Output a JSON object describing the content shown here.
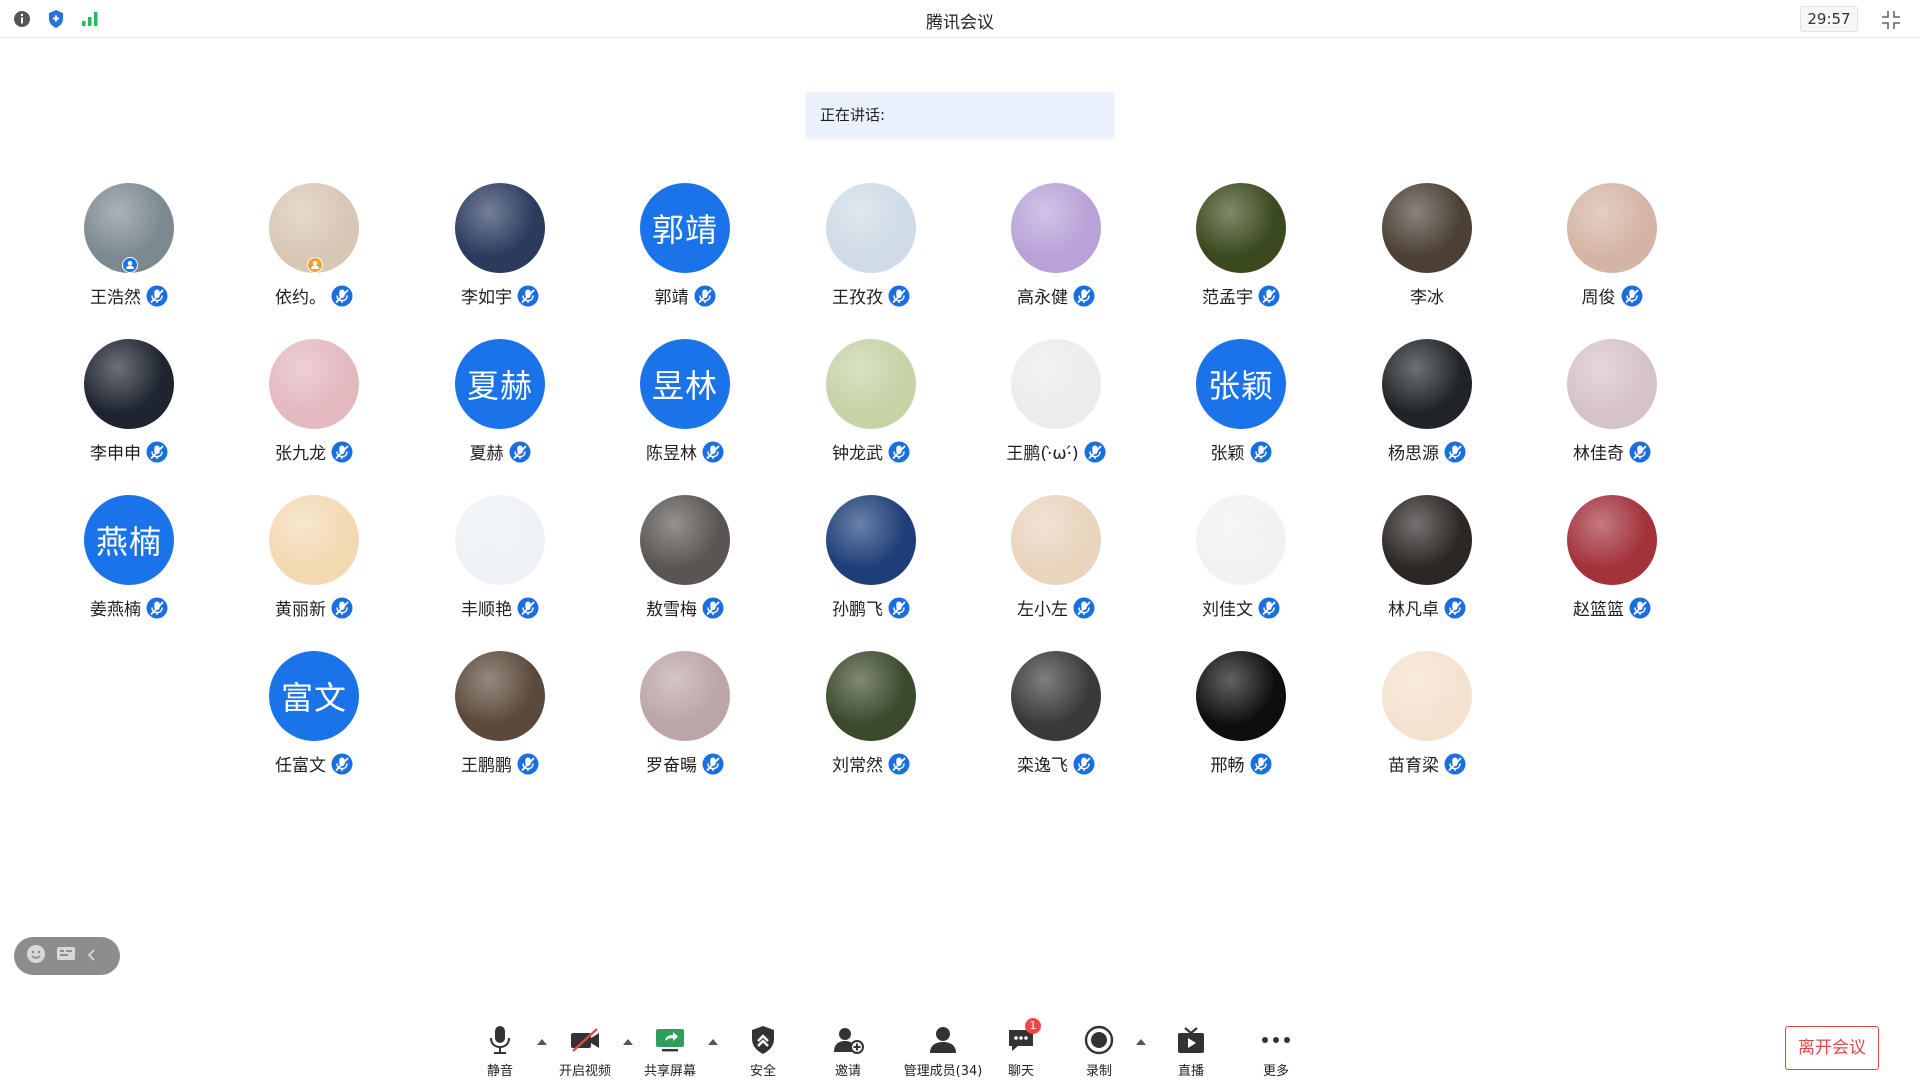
{
  "titlebar": {
    "title": "腾讯会议",
    "timer": "29:57",
    "icons": [
      "info-icon",
      "shield-icon",
      "signal-icon",
      "fullscreen-icon"
    ]
  },
  "speaking": {
    "label": "正在讲话:"
  },
  "participants": [
    {
      "name": "王浩然",
      "avatar": "photo",
      "color": "#7c8a90",
      "badge": "host"
    },
    {
      "name": "依约。",
      "avatar": "photo",
      "color": "#d8c7b5",
      "badge": "cohost"
    },
    {
      "name": "李如宇",
      "avatar": "photo",
      "color": "#2b3b5e"
    },
    {
      "name": "郭靖",
      "avatar": "text",
      "text": "郭靖"
    },
    {
      "name": "王孜孜",
      "avatar": "photo",
      "color": "#cfdbe6"
    },
    {
      "name": "高永健",
      "avatar": "photo",
      "color": "#b9a2d8"
    },
    {
      "name": "范孟宇",
      "avatar": "photo",
      "color": "#3a4a1e"
    },
    {
      "name": "李冰",
      "avatar": "photo",
      "color": "#4c4035",
      "mic": false
    },
    {
      "name": "周俊",
      "avatar": "photo",
      "color": "#d4b5a3"
    },
    {
      "name": "李申申",
      "avatar": "photo",
      "color": "#1e2530"
    },
    {
      "name": "张九龙",
      "avatar": "photo",
      "color": "#e4b8bf"
    },
    {
      "name": "夏赫",
      "avatar": "text",
      "text": "夏赫"
    },
    {
      "name": "陈昱林",
      "avatar": "text",
      "text": "昱林"
    },
    {
      "name": "钟龙武",
      "avatar": "photo",
      "color": "#c5d3a6"
    },
    {
      "name": "王鹏(·̀ω·́)",
      "avatar": "photo",
      "color": "#ececec"
    },
    {
      "name": "张颖",
      "avatar": "text",
      "text": "张颖"
    },
    {
      "name": "杨思源",
      "avatar": "photo",
      "color": "#202428"
    },
    {
      "name": "林佳奇",
      "avatar": "photo",
      "color": "#d6c3c8"
    },
    {
      "name": "姜燕楠",
      "avatar": "text",
      "text": "燕楠"
    },
    {
      "name": "黄丽新",
      "avatar": "photo",
      "color": "#f3d9b2"
    },
    {
      "name": "丰顺艳",
      "avatar": "photo",
      "color": "#eef2f6"
    },
    {
      "name": "敖雪梅",
      "avatar": "photo",
      "color": "#5a5552"
    },
    {
      "name": "孙鹏飞",
      "avatar": "photo",
      "color": "#1d3e78"
    },
    {
      "name": "左小左",
      "avatar": "photo",
      "color": "#e9d4bd"
    },
    {
      "name": "刘佳文",
      "avatar": "photo",
      "color": "#f2f2f2"
    },
    {
      "name": "林凡卓",
      "avatar": "photo",
      "color": "#2c2624"
    },
    {
      "name": "赵篮篮",
      "avatar": "photo",
      "color": "#a3323b"
    },
    {
      "name": "任富文",
      "avatar": "text",
      "text": "富文"
    },
    {
      "name": "王鹏鹏",
      "avatar": "photo",
      "color": "#5b4a3b"
    },
    {
      "name": "罗奋暘",
      "avatar": "photo",
      "color": "#bba5a6"
    },
    {
      "name": "刘常然",
      "avatar": "photo",
      "color": "#3b4a2b"
    },
    {
      "name": "栾逸飞",
      "avatar": "photo",
      "color": "#3a3a3a"
    },
    {
      "name": "邢畅",
      "avatar": "photo",
      "color": "#0e0e0e"
    },
    {
      "name": "苗育梁",
      "avatar": "photo",
      "color": "#f4e2cf"
    }
  ],
  "toolbar": {
    "mute": "静音",
    "video": "开启视频",
    "share": "共享屏幕",
    "security": "安全",
    "invite": "邀请",
    "members": "管理成员(34)",
    "chat": "聊天",
    "chat_badge": "1",
    "record": "录制",
    "live": "直播",
    "more": "更多"
  },
  "leave": "离开会议",
  "colors": {
    "accent": "#1a73e8",
    "danger": "#e24a4a",
    "mic_blue": "#1a6fe0"
  }
}
